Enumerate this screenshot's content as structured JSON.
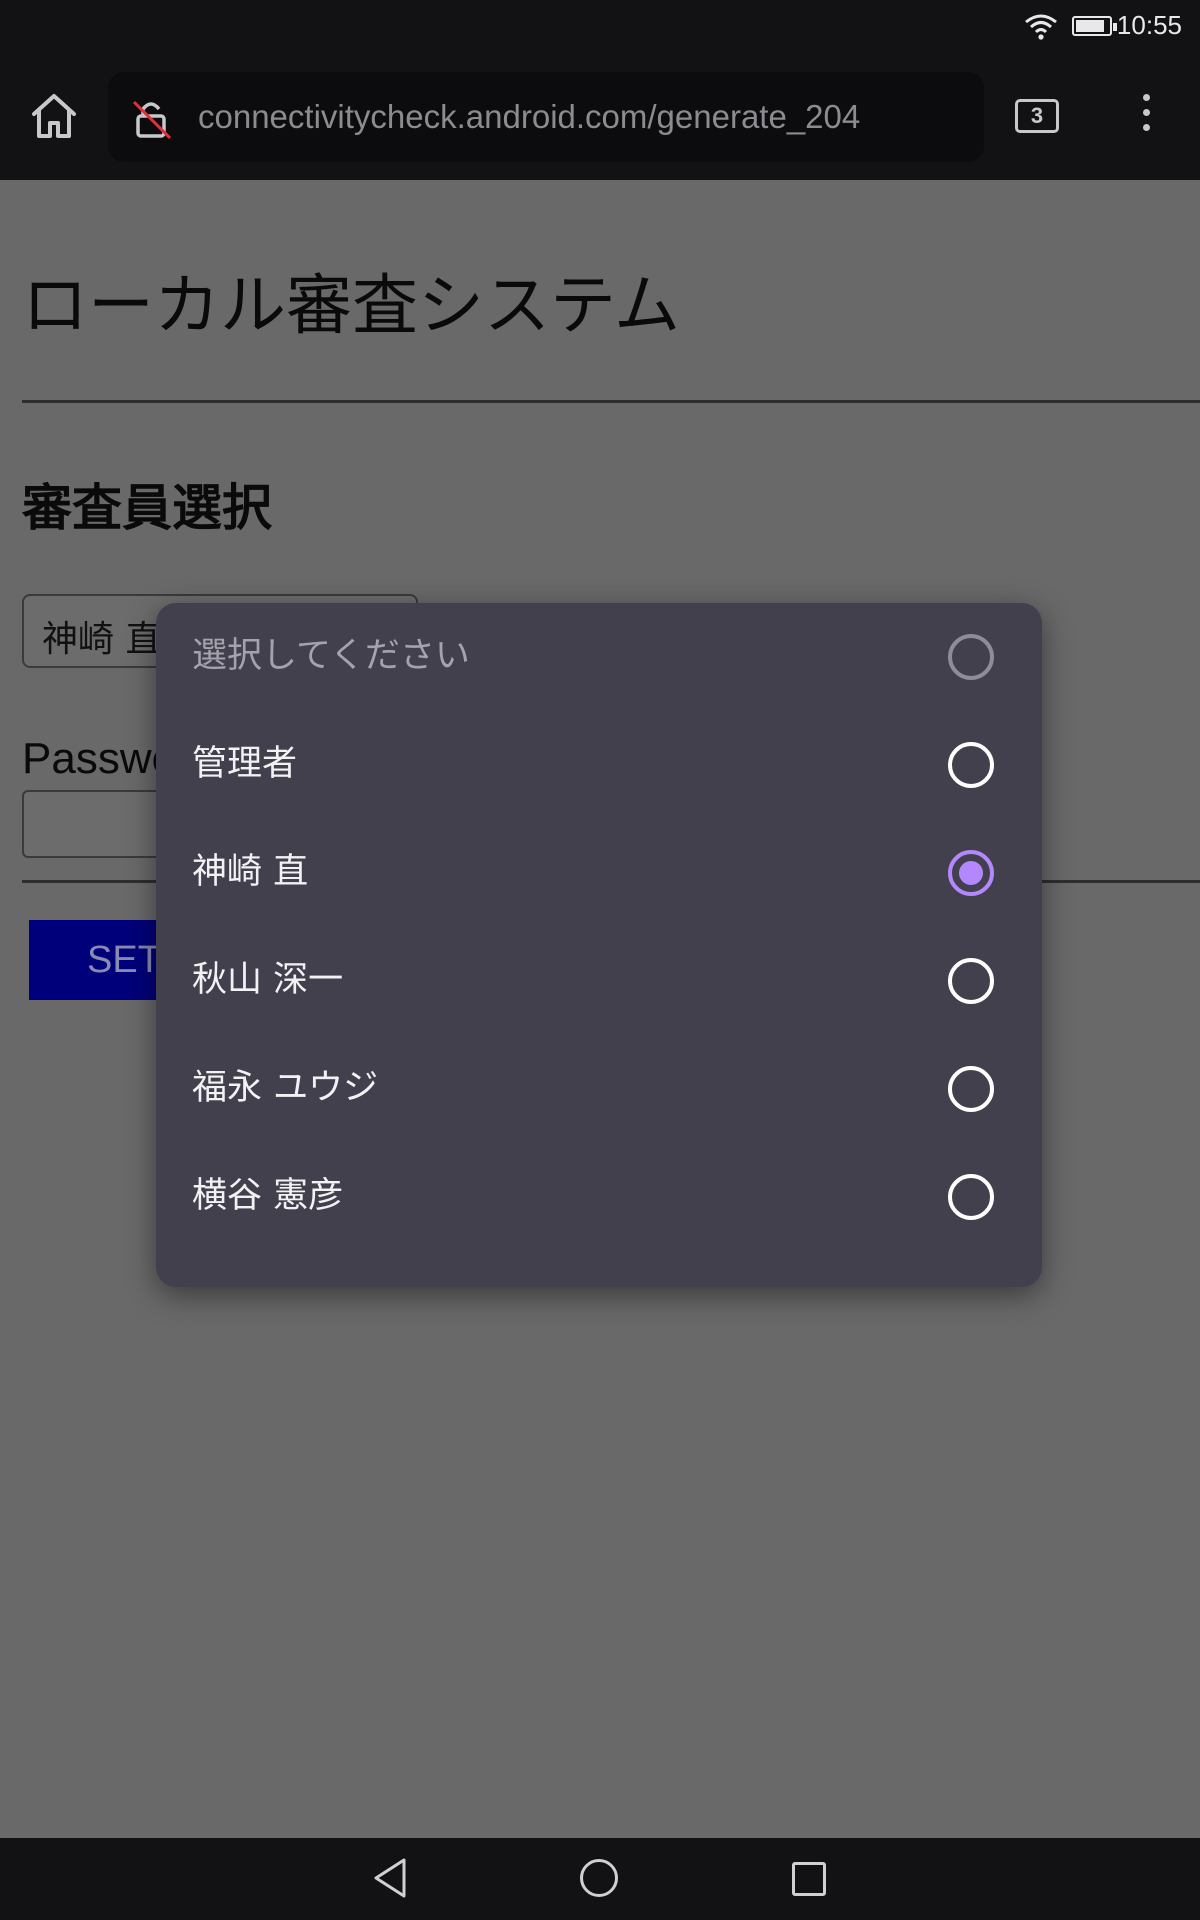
{
  "status_bar": {
    "time": "10:55",
    "icons": [
      "wifi-icon",
      "battery-icon"
    ]
  },
  "browser": {
    "url": "connectivitycheck.android.com/generate_204",
    "tab_count": "3",
    "icons": [
      "home-icon",
      "lock-off-icon",
      "more-vert-icon"
    ]
  },
  "page": {
    "title": "ローカル審査システム",
    "section_title": "審査員選択",
    "select_value": "神崎 直",
    "password_label": "Password",
    "set_button_label": "SET"
  },
  "dialog": {
    "options": [
      {
        "label": "選択してください",
        "selected": false,
        "placeholder": true
      },
      {
        "label": "管理者",
        "selected": false
      },
      {
        "label": "神崎 直",
        "selected": true
      },
      {
        "label": "秋山 深一",
        "selected": false
      },
      {
        "label": "福永 ユウジ",
        "selected": false
      },
      {
        "label": "横谷 憲彦",
        "selected": false
      }
    ]
  },
  "colors": {
    "accent": "#b388ff",
    "dialog_bg": "#43404e",
    "button_bg": "#00007a"
  },
  "nav": {
    "icons": [
      "back-icon",
      "home-circle-icon",
      "recents-icon"
    ]
  }
}
